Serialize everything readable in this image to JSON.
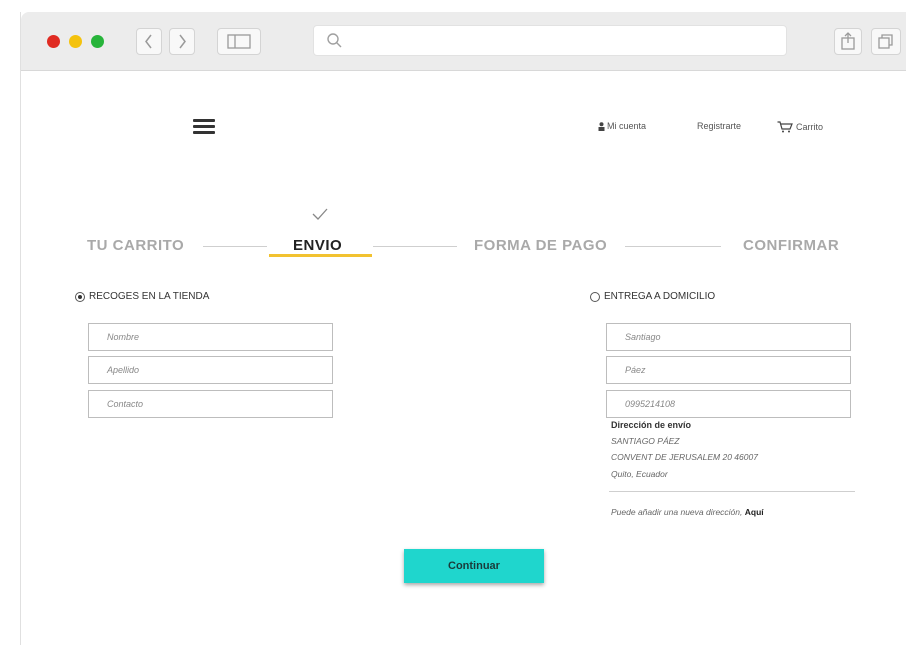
{
  "browser": {
    "icons": [
      "back-icon",
      "forward-icon",
      "sidebar-icon",
      "search-icon",
      "share-icon",
      "tabs-icon"
    ],
    "traffic_colors": [
      "#e02b22",
      "#f4c20d",
      "#27b43a"
    ]
  },
  "header": {
    "account": "Mi cuenta",
    "register": "Registrarte",
    "cart": "Carrito"
  },
  "steps": [
    {
      "label": "TU CARRITO"
    },
    {
      "label": "ENVIO"
    },
    {
      "label": "FORMA DE PAGO"
    },
    {
      "label": "CONFIRMAR"
    }
  ],
  "pickup": {
    "label": "RECOGES EN LA TIENDA",
    "fields": [
      "Nombre",
      "Apellido",
      "Contacto"
    ]
  },
  "delivery": {
    "label": "ENTREGA A DOMICILIO",
    "fields": [
      "Santiago",
      "Páez",
      "0995214108"
    ],
    "address_title": "Dirección de envío",
    "address_lines": [
      "SANTIAGO PÁEZ",
      "CONVENT DE JERUSALEM 20 46007",
      "Quito, Ecuador"
    ],
    "note": "Puede añadir una nueva dirección,",
    "note_link": "Aquí"
  },
  "continue_label": "Continuar",
  "accent_color": "#1fd6cd",
  "step_underline_color": "#f2c230"
}
